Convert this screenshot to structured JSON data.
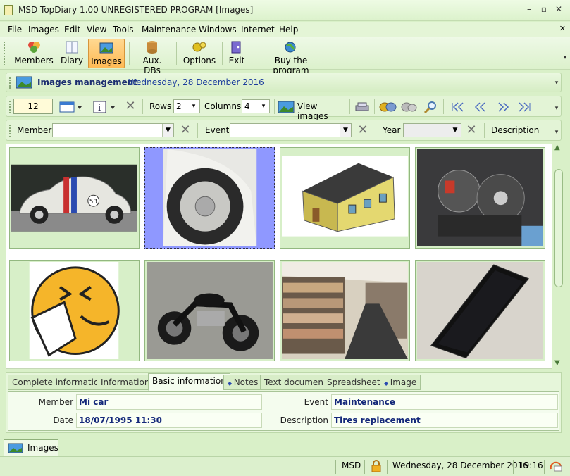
{
  "window": {
    "title": "MSD TopDiary 1.00 UNREGISTERED PROGRAM [Images]"
  },
  "menu": {
    "items": [
      "File",
      "Images",
      "Edit",
      "View",
      "Tools",
      "Maintenance",
      "Windows",
      "Internet",
      "Help"
    ]
  },
  "toolbar": {
    "buttons": [
      "Members",
      "Diary",
      "Images",
      "Aux. DBs",
      "Options",
      "Exit",
      "Buy the program"
    ],
    "active": "Images"
  },
  "images_header": {
    "title": "Images management",
    "date": "Wednesday, 28 December 2016"
  },
  "image_toolbar": {
    "count": "12",
    "rows_label": "Rows",
    "rows_value": "2",
    "columns_label": "Columns",
    "columns_value": "4",
    "view_images_label": "View images"
  },
  "filter_bar": {
    "member_label": "Member",
    "member_value": "",
    "event_label": "Event",
    "event_value": "",
    "year_label": "Year",
    "year_value": "",
    "description_label": "Description"
  },
  "gallery": {
    "thumbnails": [
      {
        "name": "thumb-car",
        "icon": "beetle-car"
      },
      {
        "name": "thumb-wheel",
        "icon": "car-wheel",
        "selected": true
      },
      {
        "name": "thumb-house",
        "icon": "house"
      },
      {
        "name": "thumb-engine",
        "icon": "engine"
      },
      {
        "name": "thumb-sneeze",
        "icon": "sneeze-emoji"
      },
      {
        "name": "thumb-motorcycle",
        "icon": "motorcycle"
      },
      {
        "name": "thumb-store",
        "icon": "store-shelves"
      },
      {
        "name": "thumb-phone",
        "icon": "smartphone"
      }
    ]
  },
  "tabs": {
    "items": [
      "Complete information",
      "Information",
      "Basic information",
      "Notes",
      "Text document",
      "Spreadsheet",
      "Image"
    ],
    "active": "Basic information"
  },
  "details": {
    "member_label": "Member",
    "member_value": "Mi car",
    "date_label": "Date",
    "date_value": "18/07/1995 11:30",
    "event_label": "Event",
    "event_value": "Maintenance",
    "description_label": "Description",
    "description_value": "Tires replacement"
  },
  "taskbar": {
    "item_label": "Images"
  },
  "status": {
    "user": "MSD",
    "date": "Wednesday, 28 December 2016",
    "time": "19:16"
  },
  "colors": {
    "background": "#d9f0c8",
    "accent": "#ffba55",
    "field_text": "#14287a"
  }
}
